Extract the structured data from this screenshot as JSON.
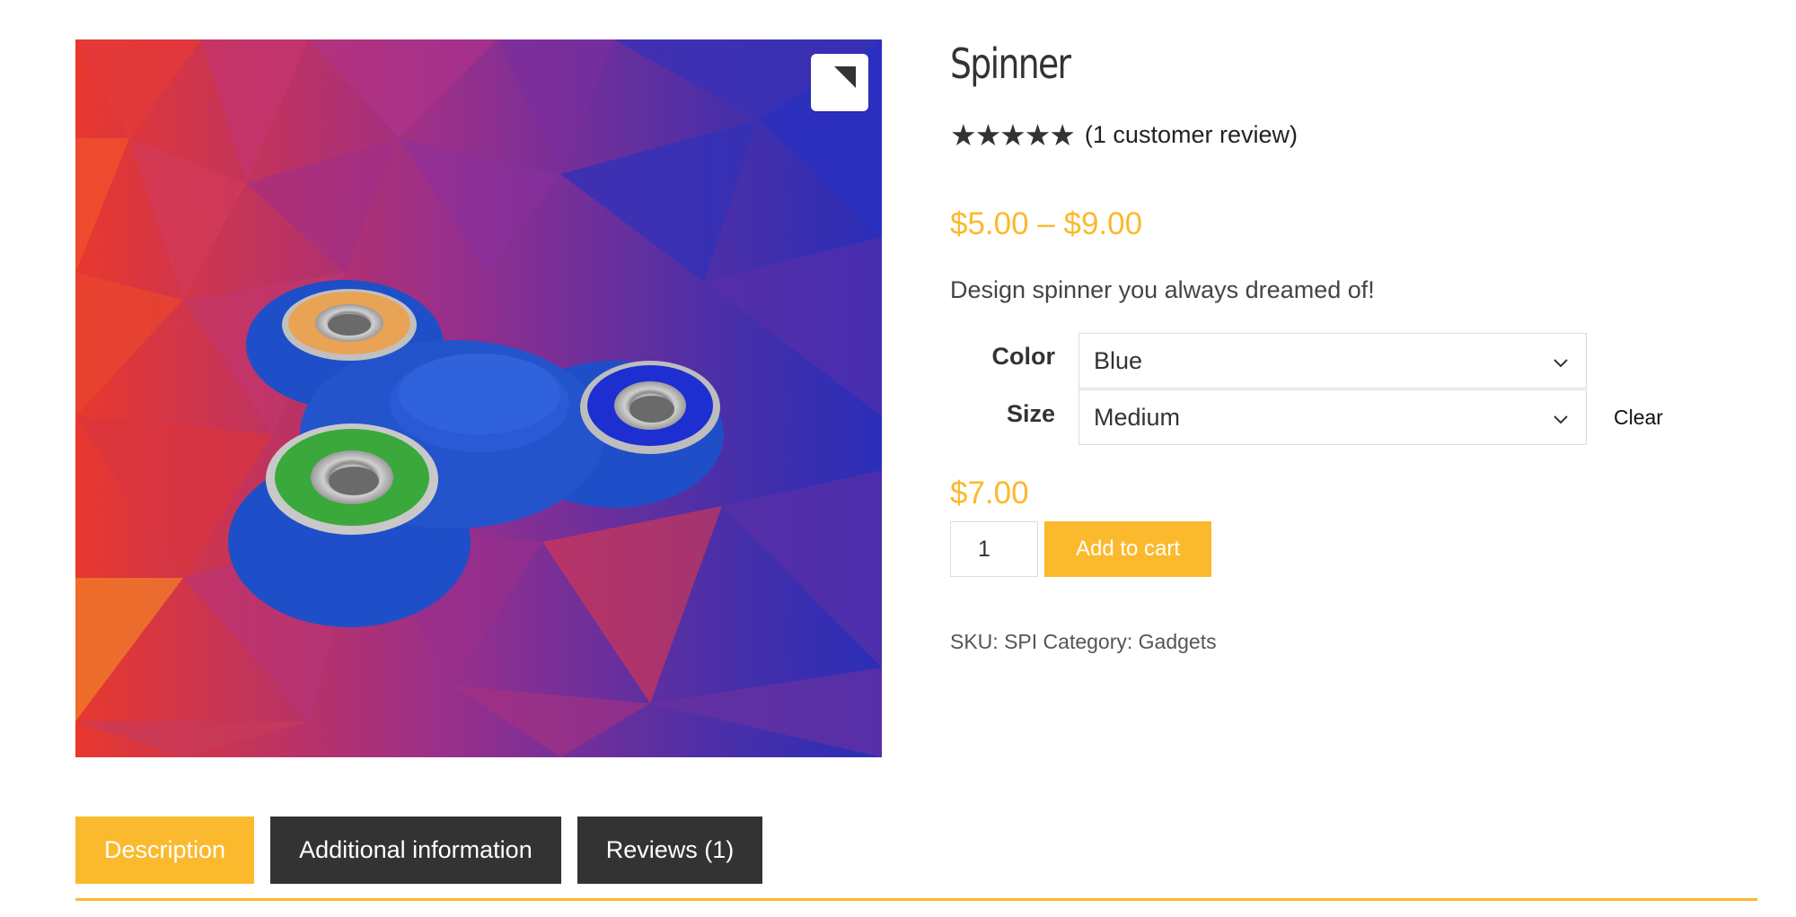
{
  "product": {
    "title": "Spinner",
    "rating_stars": "★★★★★",
    "rating_value": 5,
    "review_link": "(1 customer review)",
    "price_range": "$5.00 – $9.00",
    "short_description": "Design spinner you always dreamed of!"
  },
  "variations": {
    "color_label": "Color",
    "color_value": "Blue",
    "size_label": "Size",
    "size_value": "Medium",
    "clear_label": "Clear"
  },
  "cart": {
    "variation_price": "$7.00",
    "quantity": "1",
    "add_to_cart_label": "Add to cart"
  },
  "meta": {
    "sku_label": "SKU:",
    "sku_value": "SPI",
    "category_label": "Category:",
    "category_value": "Gadgets"
  },
  "tabs": [
    {
      "label": "Description",
      "active": true
    },
    {
      "label": "Additional information",
      "active": false
    },
    {
      "label": "Reviews (1)",
      "active": false
    }
  ],
  "icons": {
    "zoom": "zoom-corner-icon",
    "select_arrow": "chevron-down-icon",
    "star": "star-icon"
  },
  "colors": {
    "accent": "#fbb92d",
    "tab_dark": "#333333",
    "text": "#333333"
  }
}
